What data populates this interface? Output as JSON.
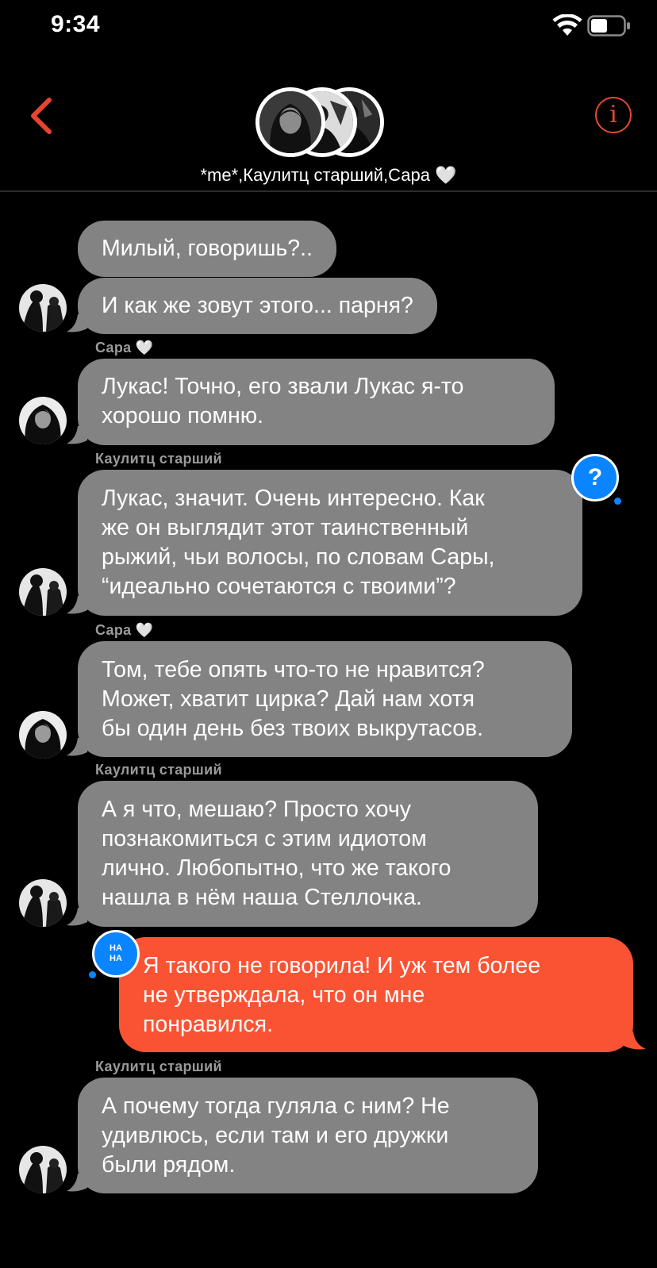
{
  "status_bar": {
    "time": "9:34"
  },
  "header": {
    "group_title": "*me*,Каулитц старший,Сара 🤍"
  },
  "messages": [
    {
      "sender": "",
      "text": "Милый, говоришь?..",
      "direction": "incoming"
    },
    {
      "sender": "",
      "text": "И как же зовут этого... парня?",
      "direction": "incoming"
    },
    {
      "sender": "Сара 🤍",
      "text": "Лукас! Точно, его звали Лукас я-то\nхорошо помню.",
      "direction": "incoming"
    },
    {
      "sender": "Каулитц старший",
      "text": "Лукас, значит. Очень интересно. Как\nже он выглядит этот таинственный\nрыжий, чьи волосы, по словам Сары,\n“идеально сочетаются с твоими”?",
      "direction": "incoming",
      "reaction": "?"
    },
    {
      "sender": "Сара 🤍",
      "text": "Том, тебе опять что-то не нравится?\nМожет, хватит цирка? Дай нам хотя\nбы один день без твоих выкрутасов.",
      "direction": "incoming"
    },
    {
      "sender": "Каулитц старший",
      "text": "А я что, мешаю? Просто хочу\nпознакомиться с этим идиотом\nлично. Любопытно, что же такого\nнашла в нём наша Стеллочка.",
      "direction": "incoming"
    },
    {
      "sender": "",
      "text": "Я такого не говорила! И уж тем более\nне утверждала, что он мне\nпонравился.",
      "direction": "outgoing",
      "reaction": "HA HA"
    },
    {
      "sender": "Каулитц старший",
      "text": "А почему тогда гуляла с ним? Не\nудивлюсь, если там и его дружки\nбыли рядом.",
      "direction": "incoming"
    }
  ],
  "colors": {
    "accent": "#e8442f",
    "incoming_bubble": "#838383",
    "outgoing_bubble": "#fa5334",
    "reaction": "#0a84ff"
  }
}
